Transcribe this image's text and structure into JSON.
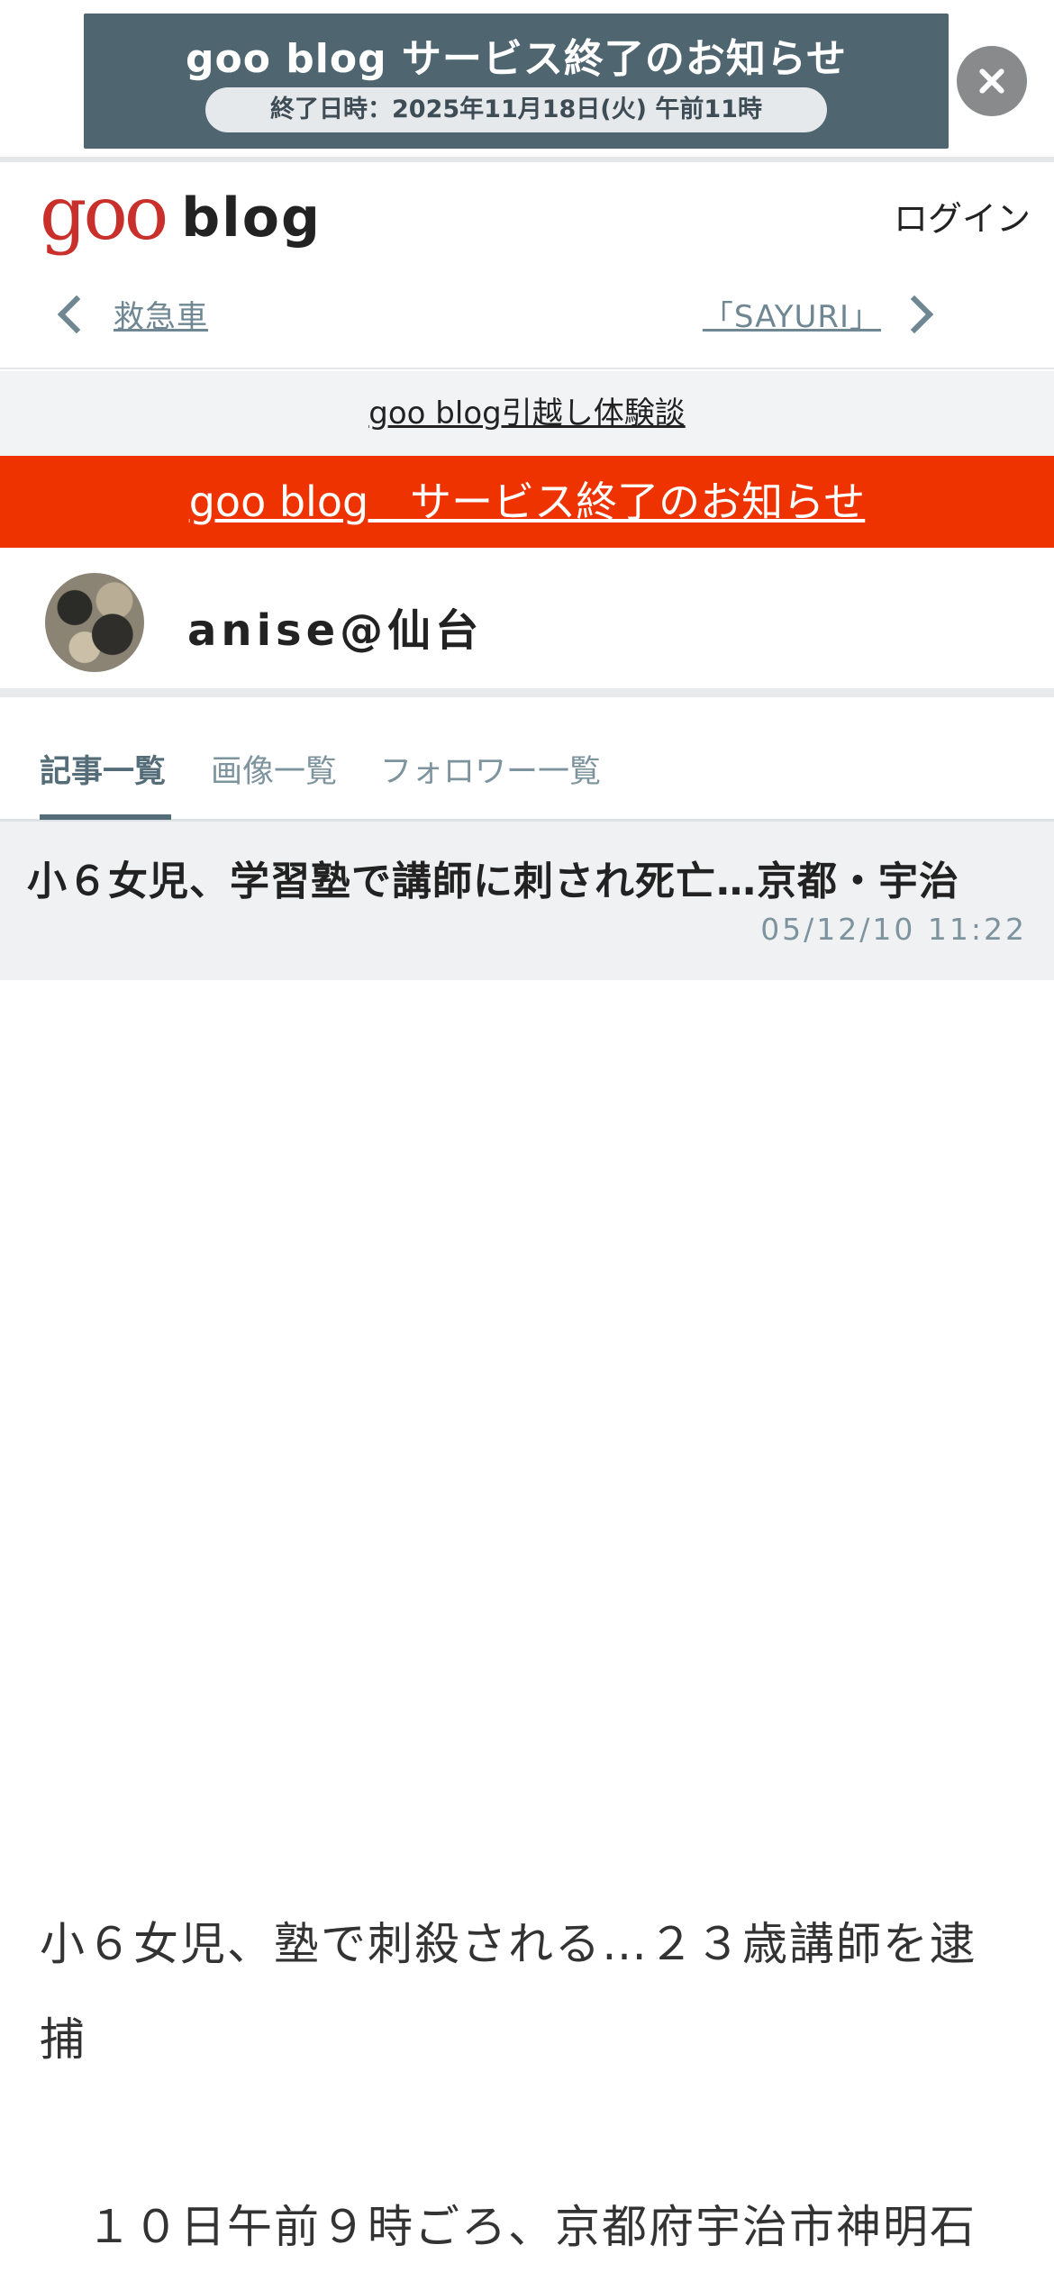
{
  "ad": {
    "title": "goo blog サービス終了のお知らせ",
    "subtitle": "終了日時：2025年11月18日(火) 午前11時"
  },
  "header": {
    "logo_goo": "goo",
    "logo_blog": "blog",
    "login": "ログイン",
    "prev_article": "救急車",
    "next_article": "「SAYURI」"
  },
  "migration_link": "goo blog引越し体験談",
  "notice": "goo blog　サービス終了のお知らせ",
  "profile": {
    "user_name": "anise@仙台"
  },
  "tabs": [
    {
      "label": "記事一覧",
      "active": true
    },
    {
      "label": "画像一覧",
      "active": false
    },
    {
      "label": "フォロワー一覧",
      "active": false
    }
  ],
  "article": {
    "title": "小６女児、学習塾で講師に刺され死亡…京都・宇治",
    "date": "05/12/10 11:22",
    "body_lines": [
      "小６女児、塾で刺殺される…２３歳講師を逮",
      "捕",
      "　１０日午前９時ごろ、京都府宇治市神明石"
    ]
  }
}
